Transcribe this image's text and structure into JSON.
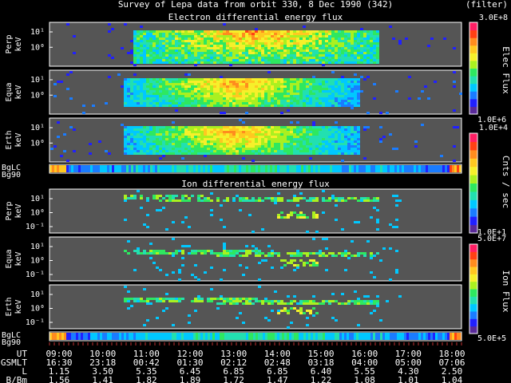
{
  "title": "Survey of Lepa data from orbit 330,  8 Dec 1990 (342)",
  "filter_label": "(filter)",
  "chart_data": [
    {
      "type": "heatmap",
      "title": "Electron differential energy flux",
      "panels": [
        {
          "label": "Perp",
          "unit": "keV",
          "y_ticks": [
            "10¹",
            "10⁰"
          ]
        },
        {
          "label": "Equa",
          "unit": "keV",
          "y_ticks": [
            "10¹",
            "10⁰"
          ]
        },
        {
          "label": "Erth",
          "unit": "keV",
          "y_ticks": [
            "10¹",
            "10⁰"
          ]
        }
      ],
      "colorbar": {
        "label": "Elec Flux",
        "max": "3.0E+8",
        "min": "1.0E+6"
      }
    },
    {
      "type": "heatmap",
      "title": "Ion differential energy flux",
      "panels": [
        {
          "label": "Perp",
          "unit": "keV",
          "y_ticks": [
            "10¹",
            "10⁰",
            "10⁻¹"
          ]
        },
        {
          "label": "Equa",
          "unit": "keV",
          "y_ticks": [
            "10¹",
            "10⁰",
            "10⁻¹"
          ]
        },
        {
          "label": "Erth",
          "unit": "keV",
          "y_ticks": [
            "10¹",
            "10⁰",
            "10⁻¹"
          ]
        }
      ],
      "colorbar": {
        "label": "Ion Flux",
        "max": "5.0E+7",
        "min": "5.0E+5"
      }
    }
  ],
  "counts_colorbar": {
    "label": "Cnts / sec",
    "max": "1.0E+4",
    "min": "1.0E+1"
  },
  "bg_labels": [
    "BgLC",
    "Bg90"
  ],
  "axis": {
    "rows": [
      {
        "name": "UT",
        "values": [
          "09:00",
          "10:00",
          "11:00",
          "12:00",
          "13:00",
          "14:00",
          "15:00",
          "16:00",
          "17:00",
          "18:00"
        ]
      },
      {
        "name": "GSMLT",
        "values": [
          "16:30",
          "23:18",
          "00:42",
          "01:30",
          "02:12",
          "02:48",
          "03:18",
          "04:00",
          "05:00",
          "07:06"
        ]
      },
      {
        "name": "L",
        "values": [
          "1.15",
          "3.50",
          "5.35",
          "6.45",
          "6.85",
          "6.85",
          "6.40",
          "5.55",
          "4.30",
          "2.50"
        ]
      },
      {
        "name": "B/Bm",
        "values": [
          "1.56",
          "1.41",
          "1.82",
          "1.89",
          "1.72",
          "1.47",
          "1.22",
          "1.08",
          "1.01",
          "1.04"
        ]
      }
    ]
  }
}
